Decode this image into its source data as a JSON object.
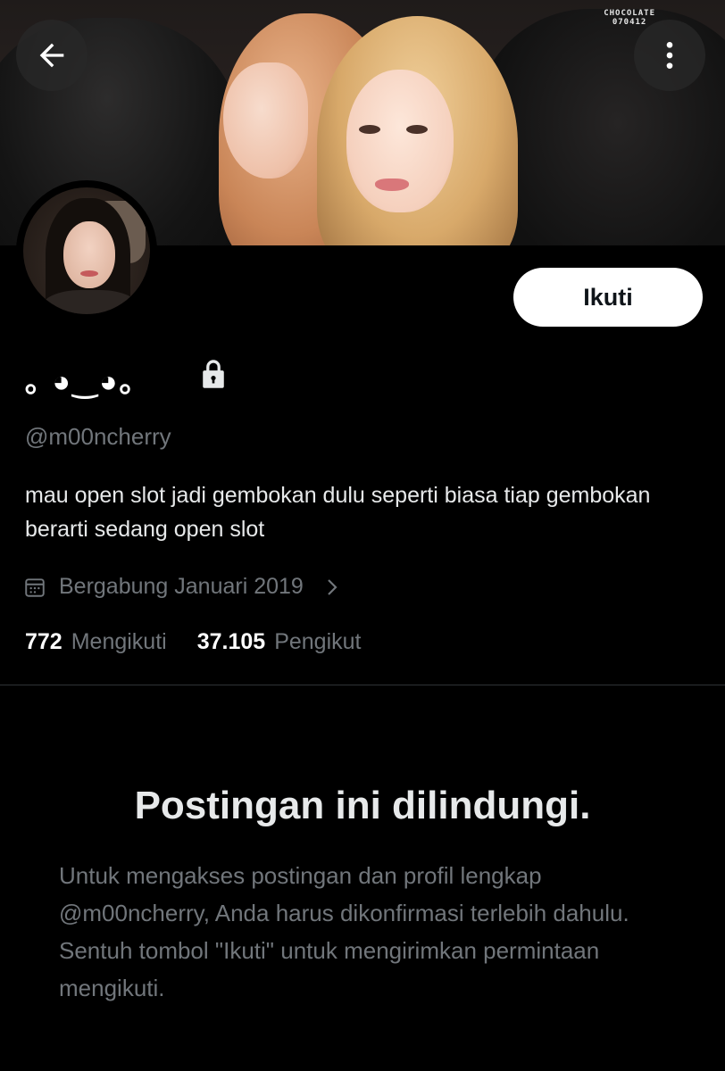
{
  "header": {
    "back_icon": "arrow-left-icon",
    "more_icon": "more-vertical-icon",
    "banner_watermark_line1": "CHOCOLATE",
    "banner_watermark_line2": "070412"
  },
  "profile": {
    "display_name": "｡ ◕‿◕｡",
    "protected_icon": "lock-icon",
    "handle": "@m00ncherry",
    "bio": "mau open slot jadi gembokan dulu seperti biasa tiap gembokan berarti sedang open slot",
    "joined": "Bergabung Januari 2019",
    "follow_label": "Ikuti"
  },
  "stats": {
    "following_count": "772",
    "following_label": "Mengikuti",
    "followers_count": "37.105",
    "followers_label": "Pengikut"
  },
  "protected_notice": {
    "title": "Postingan ini dilindungi.",
    "body": "Untuk mengakses postingan dan profil lengkap @m00ncherry, Anda harus dikonfirmasi terlebih dahulu. Sentuh tombol \"Ikuti\" untuk mengirimkan permintaan mengikuti."
  },
  "colors": {
    "background": "#000000",
    "primary_text": "#e7e9ea",
    "secondary_text": "#71767b",
    "follow_button_bg": "#ffffff",
    "divider": "#2f3336"
  }
}
